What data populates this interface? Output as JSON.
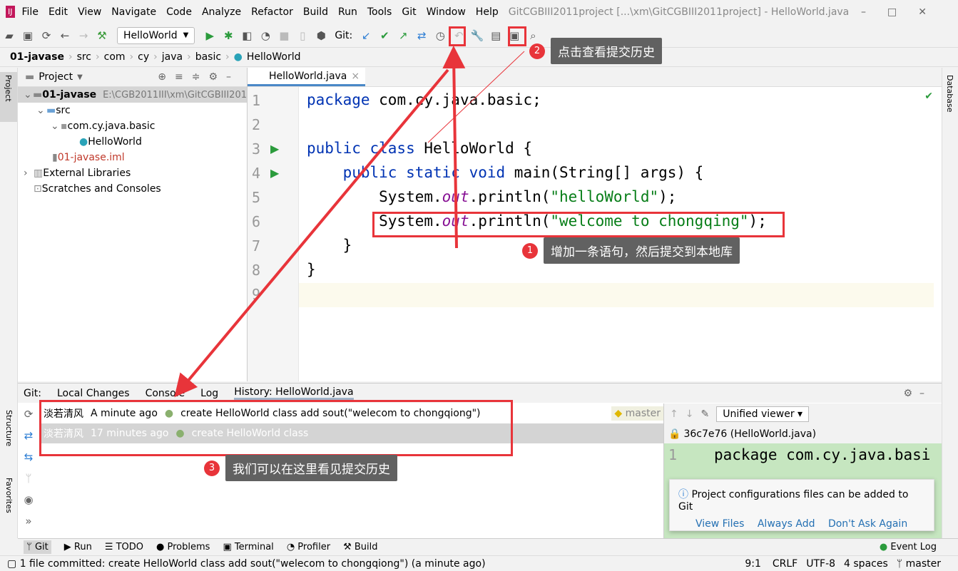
{
  "menu": {
    "items": [
      "File",
      "Edit",
      "View",
      "Navigate",
      "Code",
      "Analyze",
      "Refactor",
      "Build",
      "Run",
      "Tools",
      "Git",
      "Window",
      "Help"
    ],
    "window_title": "GitCGBIII2011project [...\\xm\\GitCGBIII2011project] - HelloWorld.java"
  },
  "toolbar": {
    "run_config": "HelloWorld",
    "git_label": "Git:"
  },
  "breadcrumb": [
    "01-javase",
    "src",
    "com",
    "cy",
    "java",
    "basic",
    "HelloWorld"
  ],
  "project": {
    "header": "Project",
    "tree": [
      {
        "label": "01-javase",
        "path": "E:\\CGB2011III\\xm\\GitCGBIII201"
      },
      {
        "label": "src"
      },
      {
        "label": "com.cy.java.basic"
      },
      {
        "label": "HelloWorld"
      },
      {
        "label": "01-javase.iml"
      },
      {
        "label": "External Libraries"
      },
      {
        "label": "Scratches and Consoles"
      }
    ]
  },
  "side_labels": {
    "project": "Project",
    "structure": "Structure",
    "favorites": "Favorites",
    "database": "Database"
  },
  "editor": {
    "tab": "HelloWorld.java",
    "line_numbers": [
      "1",
      "2",
      "3",
      "4",
      "5",
      "6",
      "7",
      "8",
      "9"
    ]
  },
  "bottom": {
    "tabs": [
      "Git:",
      "Local Changes",
      "Console",
      "Log",
      "History: HelloWorld.java"
    ],
    "history": [
      {
        "author": "淡若清风",
        "time": "A minute ago",
        "message": "create HelloWorld class add sout(\"welecom to chongqiong\")",
        "branch": "master"
      },
      {
        "author": "淡若清风",
        "time": "17 minutes ago",
        "message": "create HelloWorld class"
      }
    ],
    "viewer": "Unified viewer",
    "revision": "36c7e76 (HelloWorld.java)",
    "diff_line_number": "1",
    "diff_code": "package com.cy.java.basi"
  },
  "notification": {
    "text": "Project configurations files can be added to Git",
    "actions": [
      "View Files",
      "Always Add",
      "Don't Ask Again"
    ]
  },
  "tool_windows": [
    "Git",
    "Run",
    "TODO",
    "Problems",
    "Terminal",
    "Profiler",
    "Build"
  ],
  "event_log": "Event Log",
  "status": {
    "message": "1 file committed: create HelloWorld class add sout(\"welecom to chongqiong\") (a minute ago)",
    "position": "9:1",
    "line_sep": "CRLF",
    "encoding": "UTF-8",
    "indent": "4 spaces",
    "branch": "master"
  },
  "annotations": [
    {
      "num": "1",
      "text": "增加一条语句，然后提交到本地库"
    },
    {
      "num": "2",
      "text": "点击查看提交历史"
    },
    {
      "num": "3",
      "text": "我们可以在这里看见提交历史"
    }
  ],
  "colors": {
    "annotation_red": "#e8343a",
    "callout_bg": "#616161",
    "keyword": "#0033b3",
    "string": "#067d17"
  }
}
